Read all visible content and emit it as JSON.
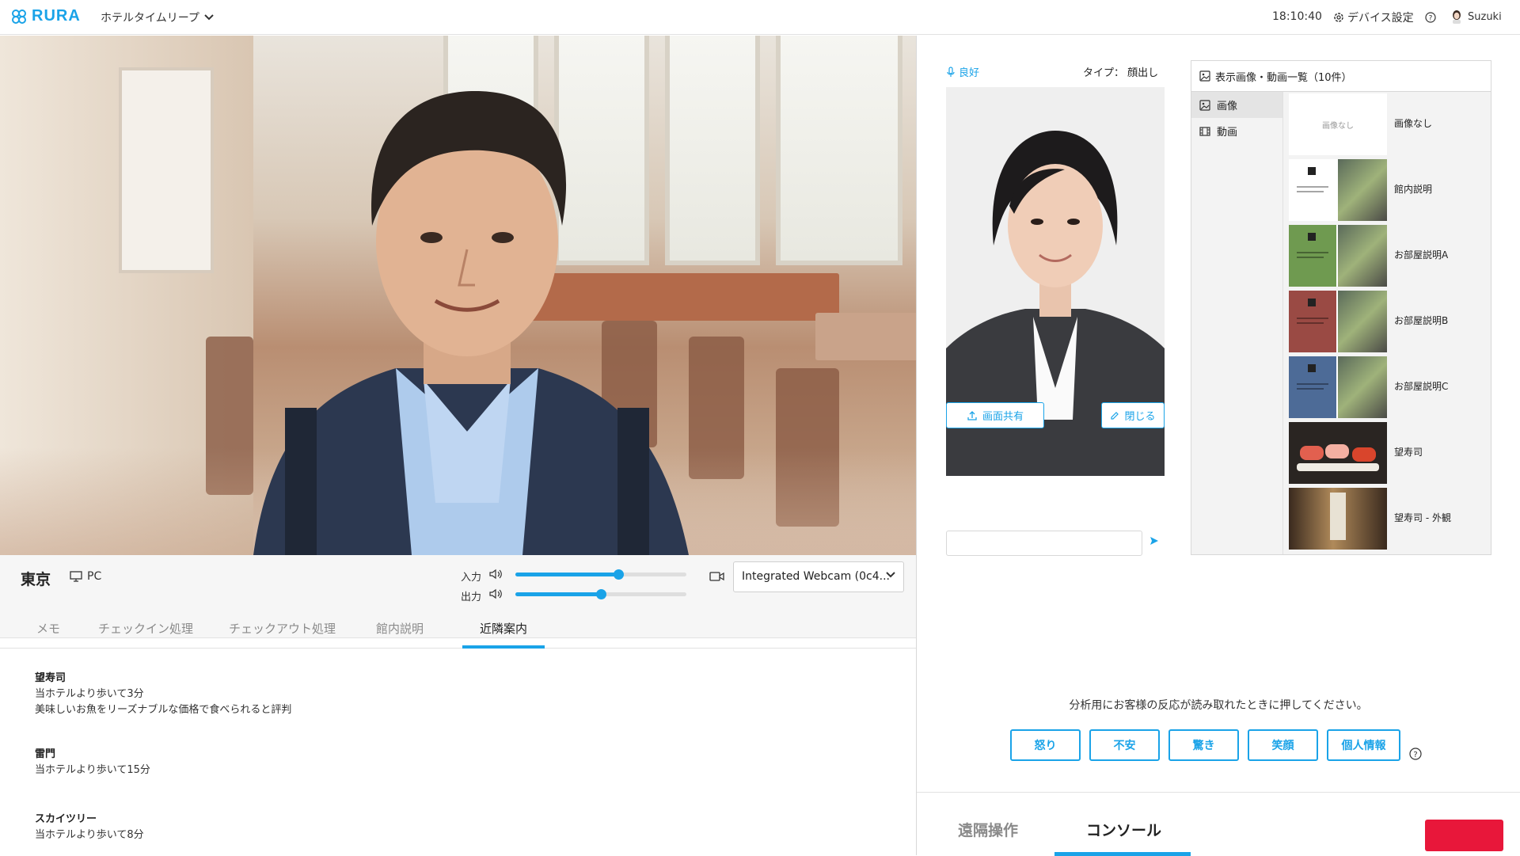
{
  "header": {
    "logo_text": "RURA",
    "facility_name": "ホテルタイムリープ",
    "clock": "18:10:40",
    "device_settings_label": "デバイス設定",
    "user_name": "Suzuki"
  },
  "guest": {
    "location": "東京",
    "device_type": "PC",
    "input_label": "入力",
    "output_label": "出力",
    "input_level": 0.6,
    "output_level": 0.5,
    "webcam": "Integrated Webcam (0c4..."
  },
  "left_tabs": [
    {
      "label": "メモ",
      "active": false
    },
    {
      "label": "チェックイン処理",
      "active": false
    },
    {
      "label": "チェックアウト処理",
      "active": false
    },
    {
      "label": "館内説明",
      "active": false
    },
    {
      "label": "近隣案内",
      "active": true
    }
  ],
  "nearby": [
    {
      "name": "望寿司",
      "lines": [
        "当ホテルより歩いて3分",
        "美味しいお魚をリーズナブルな価格で食べられると評判"
      ]
    },
    {
      "name": "雷門",
      "lines": [
        "当ホテルより歩いて15分"
      ]
    },
    {
      "name": "スカイツリー",
      "lines": [
        "当ホテルより歩いて8分"
      ]
    }
  ],
  "staff": {
    "mic_status": "良好",
    "type_label": "タイプ： 顔出し",
    "share_screen_label": "画面共有",
    "close_label": "閉じる"
  },
  "media": {
    "header": "表示画像・動画一覧（10件）",
    "categories": [
      {
        "label": "画像",
        "active": true
      },
      {
        "label": "動画",
        "active": false
      }
    ],
    "no_image_text": "画像なし",
    "items": [
      {
        "label": "画像なし",
        "kind": "none"
      },
      {
        "label": "館内説明",
        "kind": "doc-white"
      },
      {
        "label": "お部屋説明A",
        "kind": "doc-green"
      },
      {
        "label": "お部屋説明B",
        "kind": "doc-red"
      },
      {
        "label": "お部屋説明C",
        "kind": "doc-blue"
      },
      {
        "label": "望寿司",
        "kind": "sushi"
      },
      {
        "label": "望寿司 - 外観",
        "kind": "exterior"
      }
    ]
  },
  "analysis": {
    "prompt": "分析用にお客様の反応が読み取れたときに押してください。",
    "buttons": [
      "怒り",
      "不安",
      "驚き",
      "笑顔",
      "個人情報"
    ]
  },
  "right_tabs": [
    {
      "label": "遠隔操作",
      "active": false
    },
    {
      "label": "コンソール",
      "active": true
    }
  ],
  "colors": {
    "accent": "#1aa3e8",
    "danger": "#e8173a"
  }
}
